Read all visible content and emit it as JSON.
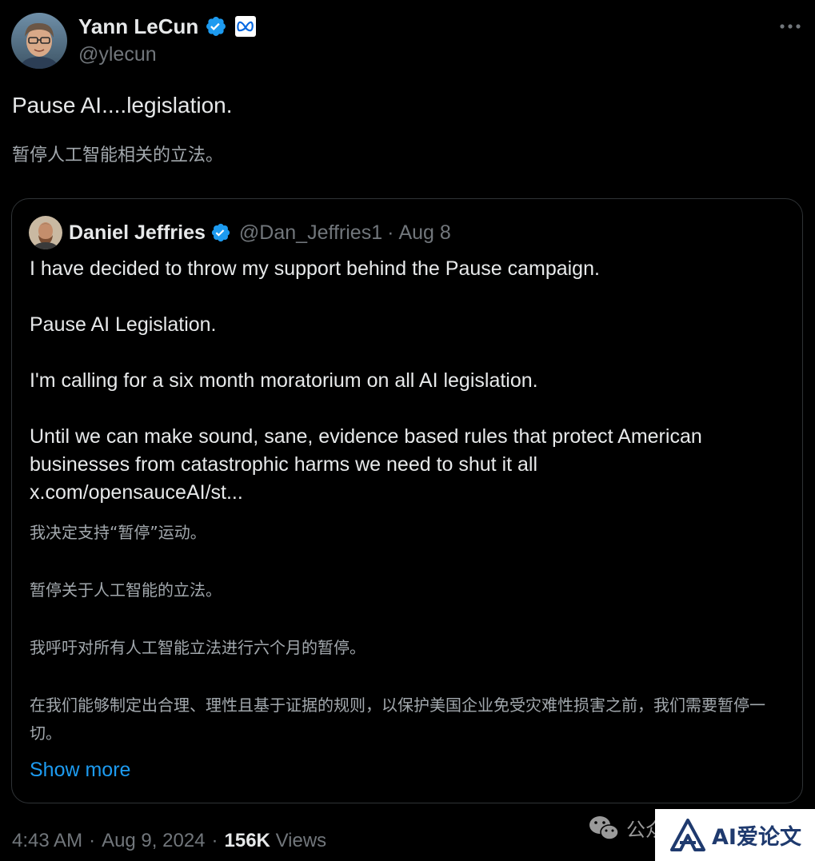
{
  "author": {
    "name": "Yann LeCun",
    "handle": "@ylecun"
  },
  "tweet": {
    "text": "Pause AI....legislation.",
    "translation": "暂停人工智能相关的立法。"
  },
  "quoted": {
    "name": "Daniel Jeffries",
    "handle": "@Dan_Jeffries1",
    "separator": "·",
    "date": "Aug 8",
    "paragraphs": [
      "I have decided to throw my support behind the Pause campaign.",
      "Pause AI Legislation.",
      "I'm calling for a six month moratorium on all AI legislation.",
      "Until we can make sound, sane, evidence based rules that protect American businesses from catastrophic harms we need to shut it all",
      "x.com/opensauceAI/st..."
    ],
    "translation_paragraphs": [
      "我决定支持“暂停”运动。",
      "暂停关于人工智能的立法。",
      "我呼吁对所有人工智能立法进行六个月的暂停。",
      "在我们能够制定出合理、理性且基于证据的规则，以保护美国企业免受灾难性损害之前，我们需要暂停一切。"
    ],
    "show_more": "Show more"
  },
  "meta": {
    "time": "4:43 AM",
    "sep1": "·",
    "date": "Aug 9, 2024",
    "sep2": "·",
    "views_count": "156K",
    "views_label": "Views"
  },
  "watermark": {
    "wechat_text": "公众",
    "badge_text": "AI爱论文"
  },
  "icons": {
    "verified": "verified-badge-icon",
    "affiliate": "meta-logo-icon",
    "more": "more-horizontal-icon"
  },
  "colors": {
    "background": "#000000",
    "text_primary": "#e7e9ea",
    "text_secondary": "#71767b",
    "link": "#1d9bf0",
    "verified": "#1d9bf0",
    "border": "#2f3336"
  }
}
